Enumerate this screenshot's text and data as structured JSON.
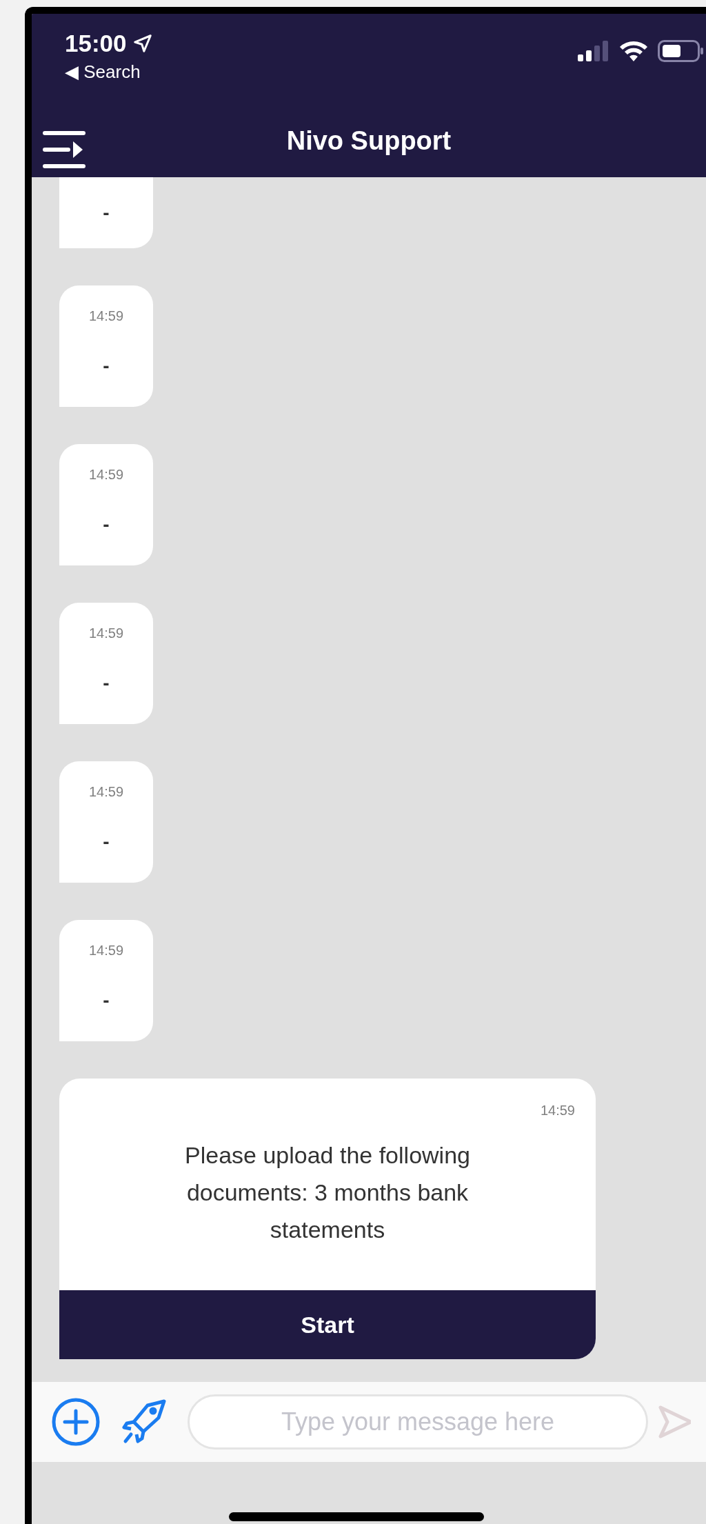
{
  "status_bar": {
    "time": "15:00",
    "back_link": "◀ Search"
  },
  "header": {
    "title": "Nivo Support"
  },
  "messages": [
    {
      "kind": "short",
      "text": "-"
    },
    {
      "kind": "short",
      "time": "14:59",
      "text": "-"
    },
    {
      "kind": "short",
      "time": "14:59",
      "text": "-"
    },
    {
      "kind": "short",
      "time": "14:59",
      "text": "-"
    },
    {
      "kind": "short",
      "time": "14:59",
      "text": "-"
    },
    {
      "kind": "short",
      "time": "14:59",
      "text": "-"
    },
    {
      "kind": "card",
      "time": "14:59",
      "text": "Please upload the following documents: 3 months bank statements",
      "button": "Start"
    }
  ],
  "composer": {
    "placeholder": "Type your message here"
  }
}
